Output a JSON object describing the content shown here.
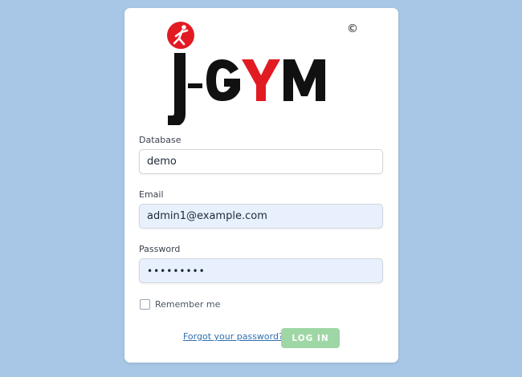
{
  "brand": {
    "logo_text_prefix": "J",
    "logo_text": "GYM",
    "copyright_symbol": "©",
    "accent_color": "#e21b23",
    "dark_color": "#111111"
  },
  "form": {
    "database_label": "Database",
    "database_value": "demo",
    "email_label": "Email",
    "email_value": "admin1@example.com",
    "password_label": "Password",
    "password_value": "•••••••••",
    "remember_label": "Remember me",
    "remember_checked": false,
    "forgot_link": "Forgot your password?",
    "login_button": "LOG IN"
  },
  "colors": {
    "page_background": "#a8c6e5",
    "autofill_background": "#e8f0fe",
    "login_button_background": "#9fd6a5",
    "link_color": "#2f6fb0"
  }
}
